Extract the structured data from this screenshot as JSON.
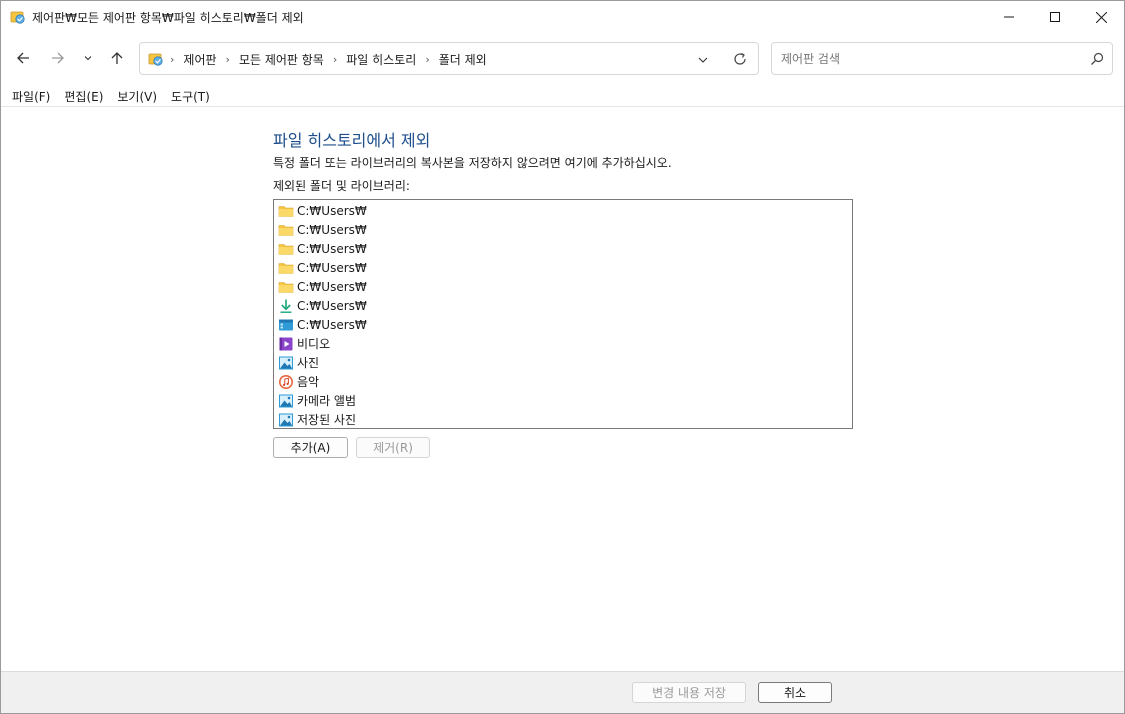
{
  "window": {
    "title": "제어판₩모든 제어판 항목₩파일 히스토리₩폴더 제외"
  },
  "nav": {
    "back_icon": "arrow-left-icon",
    "forward_icon": "arrow-right-icon",
    "recent_icon": "chevron-down-icon",
    "up_icon": "arrow-up-icon",
    "breadcrumbs": [
      "제어판",
      "모든 제어판 항목",
      "파일 히스토리",
      "폴더 제외"
    ],
    "search_placeholder": "제어판 검색"
  },
  "menu": [
    "파일(F)",
    "편집(E)",
    "보기(V)",
    "도구(T)"
  ],
  "content": {
    "heading": "파일 히스토리에서 제외",
    "description": "특정 폴더 또는 라이브러리의 복사본을 저장하지 않으려면 여기에 추가하십시오.",
    "list_label": "제외된 폴더 및 라이브러리:",
    "items": [
      {
        "label": "C:₩Users₩",
        "icon": "folder-icon"
      },
      {
        "label": "C:₩Users₩",
        "icon": "folder-icon"
      },
      {
        "label": "C:₩Users₩",
        "icon": "folder-icon"
      },
      {
        "label": "C:₩Users₩",
        "icon": "folder-icon"
      },
      {
        "label": "C:₩Users₩",
        "icon": "folder-icon"
      },
      {
        "label": "C:₩Users₩",
        "icon": "download-icon"
      },
      {
        "label": "C:₩Users₩",
        "icon": "desktop-icon"
      },
      {
        "label": "비디오",
        "icon": "video-icon"
      },
      {
        "label": "사진",
        "icon": "picture-icon"
      },
      {
        "label": "음악",
        "icon": "music-icon"
      },
      {
        "label": "카메라 앨범",
        "icon": "picture-icon"
      },
      {
        "label": "저장된 사진",
        "icon": "picture-icon"
      }
    ],
    "add_button": "추가(A)",
    "remove_button": "제거(R)"
  },
  "footer": {
    "save_button": "변경 내용 저장",
    "cancel_button": "취소"
  },
  "colors": {
    "heading": "#1e4e8c",
    "folder": "#f5c542",
    "accent": "#0078d4"
  }
}
